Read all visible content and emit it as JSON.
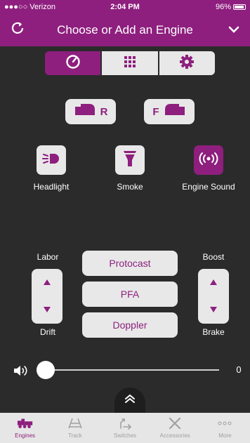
{
  "status_bar": {
    "carrier": "●●●○○ Verizon",
    "time": "2:04 PM",
    "battery": "96%"
  },
  "nav": {
    "title": "Choose or Add an Engine"
  },
  "segments": [
    {
      "icon": "speedometer-icon",
      "active": true
    },
    {
      "icon": "keypad-grid-icon",
      "active": false
    },
    {
      "icon": "gear-icon",
      "active": false
    }
  ],
  "direction": {
    "reverse_label": "R",
    "forward_label": "F"
  },
  "functions": {
    "headlight": "Headlight",
    "smoke": "Smoke",
    "engine_sound": "Engine Sound"
  },
  "controls": {
    "labor": "Labor",
    "drift": "Drift",
    "boost": "Boost",
    "brake": "Brake",
    "protocast": "Protocast",
    "pfa": "PFA",
    "doppler": "Doppler"
  },
  "volume": {
    "value": "0",
    "level": 0
  },
  "tabs": [
    {
      "label": "Engines",
      "icon": "locomotive-icon",
      "active": true
    },
    {
      "label": "Track",
      "icon": "track-icon",
      "active": false
    },
    {
      "label": "Switches",
      "icon": "switch-arrow-icon",
      "active": false
    },
    {
      "label": "Accessories",
      "icon": "crossed-tools-icon",
      "active": false
    },
    {
      "label": "More",
      "icon": "more-dots-icon",
      "active": false
    }
  ],
  "colors": {
    "accent": "#8e1f7e",
    "background": "#2b2b2b",
    "button": "#e8e8e8"
  }
}
